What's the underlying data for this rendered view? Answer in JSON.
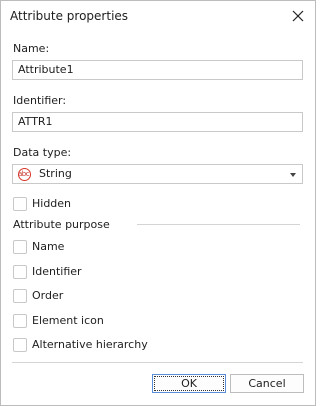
{
  "dialog": {
    "title": "Attribute properties",
    "name_label": "Name:",
    "name_value": "Attribute1",
    "identifier_label": "Identifier:",
    "identifier_value": "ATTR1",
    "data_type_label": "Data type:",
    "data_type_value": "String",
    "data_type_icon": "abc-string-icon",
    "data_type_icon_text": "abc",
    "hidden_label": "Hidden",
    "hidden_checked": false,
    "purpose_label": "Attribute purpose",
    "purpose_items": [
      {
        "label": "Name",
        "checked": false
      },
      {
        "label": "Identifier",
        "checked": false
      },
      {
        "label": "Order",
        "checked": false
      },
      {
        "label": "Element icon",
        "checked": false
      },
      {
        "label": "Alternative hierarchy",
        "checked": false
      }
    ],
    "ok_label": "OK",
    "cancel_label": "Cancel"
  },
  "colors": {
    "accent_border": "#5a8ed6",
    "icon_red": "#d7362b"
  }
}
